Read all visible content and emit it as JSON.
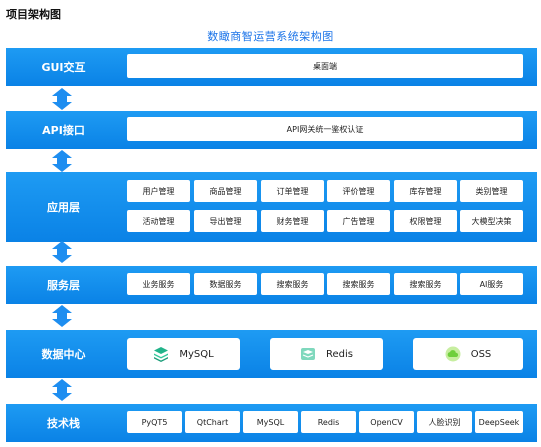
{
  "page_title": "项目架构图",
  "diagram_title": "数瞰商智运营系统架构图",
  "colors": {
    "band": "#0a82e6",
    "arrow": "#1e8ef0",
    "title": "#1a73e8"
  },
  "layers": {
    "gui": {
      "label": "GUI交互",
      "items": [
        "桌面端"
      ]
    },
    "api": {
      "label": "API接口",
      "items": [
        "API网关统一鉴权认证"
      ]
    },
    "app": {
      "label": "应用层",
      "items": [
        "用户管理",
        "商品管理",
        "订单管理",
        "评价管理",
        "库存管理",
        "类别管理",
        "活动管理",
        "导出管理",
        "财务管理",
        "广告管理",
        "权限管理",
        "大模型决策"
      ]
    },
    "service": {
      "label": "服务层",
      "items": [
        "业务服务",
        "数据服务",
        "搜索服务",
        "搜索服务",
        "搜索服务",
        "AI服务"
      ]
    },
    "data": {
      "label": "数据中心",
      "items": [
        {
          "name": "MySQL",
          "icon": "stack-layers-icon"
        },
        {
          "name": "Redis",
          "icon": "redis-cube-icon"
        },
        {
          "name": "OSS",
          "icon": "cloud-icon"
        }
      ]
    },
    "tech": {
      "label": "技术栈",
      "items": [
        "PyQT5",
        "QtChart",
        "MySQL",
        "Redis",
        "OpenCV",
        "人脸识别",
        "DeepSeek"
      ]
    }
  }
}
